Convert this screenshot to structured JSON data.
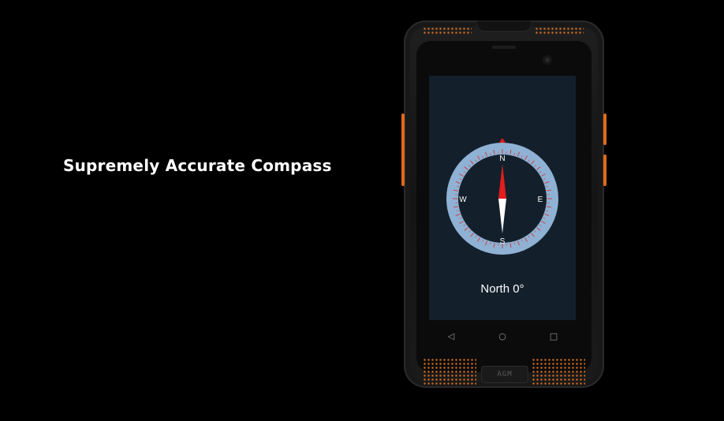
{
  "headline": "Supremely Accurate Compass",
  "compass": {
    "cardinals": {
      "north": "N",
      "east": "E",
      "south": "S",
      "west": "W"
    },
    "heading_text": "North 0°"
  },
  "nav": {
    "back_icon": "◁",
    "home_icon": "○",
    "recents_icon": "□"
  },
  "brand": "AGM",
  "colors": {
    "accent_orange": "#e06a1a",
    "screen_bg": "#13202b",
    "dial_ring": "#8fb1d4",
    "needle_red": "#e21d1d",
    "needle_white": "#ffffff"
  }
}
